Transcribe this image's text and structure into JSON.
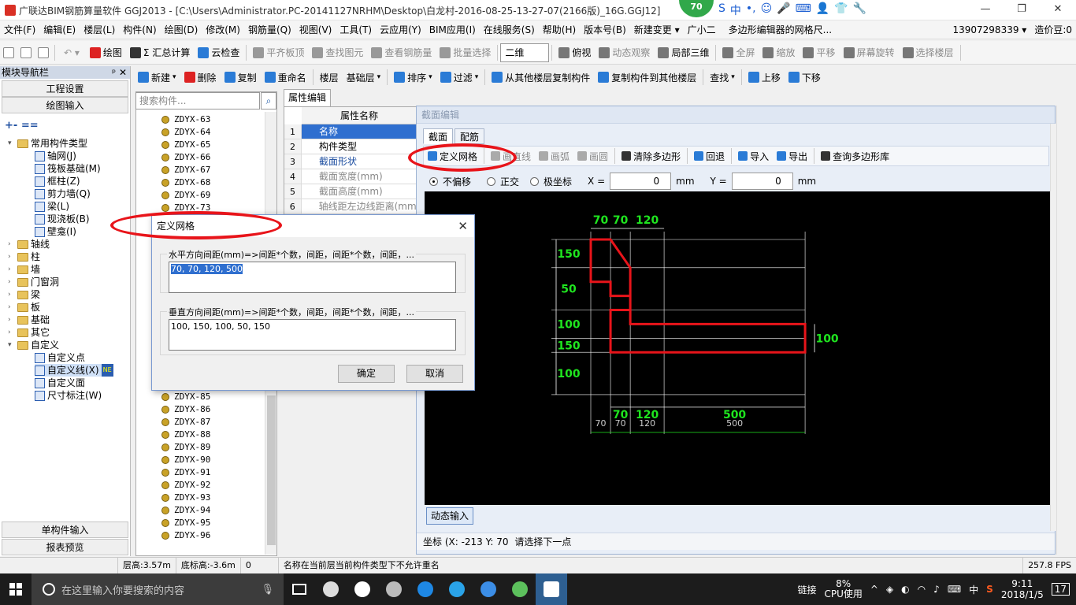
{
  "titlebar": {
    "title": "广联达BIM钢筋算量软件 GGJ2013 - [C:\\Users\\Administrator.PC-20141127NRHM\\Desktop\\白龙村-2016-08-25-13-27-07(2166版)_16G.GGJ12]",
    "badge": "70",
    "ime_items": [
      "S",
      "中",
      "•,",
      "☺",
      "🎤",
      "⌨",
      "👤",
      "👕",
      "🔧"
    ],
    "buttons": [
      "—",
      "❐",
      "✕"
    ]
  },
  "menubar": {
    "items": [
      "文件(F)",
      "编辑(E)",
      "楼层(L)",
      "构件(N)",
      "绘图(D)",
      "修改(M)",
      "钢筋量(Q)",
      "视图(V)",
      "工具(T)",
      "云应用(Y)",
      "BIM应用(I)",
      "在线服务(S)",
      "帮助(H)",
      "版本号(B)",
      "新建变更 ▾",
      "广小二",
      "多边形编辑器的网格尺...",
      "13907298339 ▾",
      "造价豆:0"
    ]
  },
  "toolbar1": {
    "items": [
      "绘图",
      "Σ 汇总计算",
      "云检查",
      "平齐板顶",
      "查找图元",
      "查看钢筋量",
      "批量选择",
      "二维",
      "俯视",
      "动态观察",
      "局部三维",
      "全屏",
      "缩放",
      "平移",
      "屏幕旋转",
      "选择楼层"
    ]
  },
  "toolbar2": {
    "items": [
      "新建",
      "删除",
      "复制",
      "重命名",
      "楼层",
      "基础层",
      "排序",
      "过滤",
      "从其他楼层复制构件",
      "复制构件到其他楼层",
      "查找",
      "上移",
      "下移"
    ]
  },
  "nav": {
    "title": "模块导航栏",
    "pin": "ᵖ ✕",
    "top_buttons": [
      "工程设置",
      "绘图输入"
    ],
    "bottom_buttons": [
      "单构件输入",
      "报表预览"
    ],
    "tree": [
      {
        "label": "常用构件类型",
        "level": 0,
        "type": "folder",
        "open": true
      },
      {
        "label": "轴网(J)",
        "level": 1,
        "type": "comp"
      },
      {
        "label": "筏板基础(M)",
        "level": 1,
        "type": "comp"
      },
      {
        "label": "框柱(Z)",
        "level": 1,
        "type": "comp"
      },
      {
        "label": "剪力墙(Q)",
        "level": 1,
        "type": "comp"
      },
      {
        "label": "梁(L)",
        "level": 1,
        "type": "comp"
      },
      {
        "label": "现浇板(B)",
        "level": 1,
        "type": "comp"
      },
      {
        "label": "壁龛(I)",
        "level": 1,
        "type": "comp"
      },
      {
        "label": "轴线",
        "level": 0,
        "type": "folder"
      },
      {
        "label": "柱",
        "level": 0,
        "type": "folder"
      },
      {
        "label": "墙",
        "level": 0,
        "type": "folder"
      },
      {
        "label": "门窗洞",
        "level": 0,
        "type": "folder"
      },
      {
        "label": "梁",
        "level": 0,
        "type": "folder"
      },
      {
        "label": "板",
        "level": 0,
        "type": "folder"
      },
      {
        "label": "基础",
        "level": 0,
        "type": "folder"
      },
      {
        "label": "其它",
        "level": 0,
        "type": "folder"
      },
      {
        "label": "自定义",
        "level": 0,
        "type": "folder",
        "open": true
      },
      {
        "label": "自定义点",
        "level": 1,
        "type": "comp"
      },
      {
        "label": "自定义线(X)",
        "level": 1,
        "type": "comp",
        "badge": "NE"
      },
      {
        "label": "自定义面",
        "level": 1,
        "type": "comp"
      },
      {
        "label": "尺寸标注(W)",
        "level": 1,
        "type": "comp"
      }
    ]
  },
  "component_list": {
    "search_placeholder": "搜索构件...",
    "items_top": [
      "ZDYX-63",
      "ZDYX-64",
      "ZDYX-65",
      "ZDYX-66",
      "ZDYX-67",
      "ZDYX-68",
      "ZDYX-69",
      "ZDYX-73"
    ],
    "items_bottom": [
      "ZDYX-85",
      "ZDYX-86",
      "ZDYX-87",
      "ZDYX-88",
      "ZDYX-89",
      "ZDYX-90",
      "ZDYX-91",
      "ZDYX-92",
      "ZDYX-93",
      "ZDYX-94",
      "ZDYX-95",
      "ZDYX-96"
    ]
  },
  "property": {
    "tab": "属性编辑",
    "header": "属性名称",
    "rows": [
      {
        "n": "1",
        "name": "名称"
      },
      {
        "n": "2",
        "name": "构件类型"
      },
      {
        "n": "3",
        "name": "截面形状"
      },
      {
        "n": "4",
        "name": "截面宽度(mm)"
      },
      {
        "n": "5",
        "name": "截面高度(mm)"
      },
      {
        "n": "6",
        "name": "轴线距左边线距离(mm)"
      }
    ]
  },
  "section_editor": {
    "title": "截面编辑",
    "tabs": [
      "截面",
      "配筋"
    ],
    "tools": [
      "定义网格",
      "画直线",
      "画弧",
      "画圆",
      "清除多边形",
      "回退",
      "导入",
      "导出",
      "查询多边形库"
    ],
    "options": [
      "不偏移",
      "正交",
      "极坐标"
    ],
    "x_label": "X =",
    "x_value": "0",
    "y_label": "Y =",
    "y_value": "0",
    "unit": "mm",
    "dynamic_input": "动态输入",
    "coord_text": "坐标 (X: -213 Y: 70",
    "coord_hint": "请选择下一点"
  },
  "drawing": {
    "x_spacing": [
      70,
      70,
      120,
      500
    ],
    "y_spacing": [
      100,
      150,
      100,
      50,
      150
    ],
    "top_labels": [
      "70",
      "70",
      "120"
    ],
    "left_labels": [
      "150",
      "50",
      "100",
      "150",
      "100"
    ],
    "bottom_labels": [
      "70",
      "120",
      "500"
    ],
    "bottom_grid_labels": [
      "70",
      "70",
      "120",
      "500"
    ],
    "right_label": "100",
    "colors": {
      "polygon": "#e8141a",
      "dim": "#1fe51f",
      "grid": "#ffffff"
    }
  },
  "dialog": {
    "title": "定义网格",
    "h_label": "水平方向间距(mm)=>间距*个数，间距，间距*个数，间距，...",
    "h_value": "70, 70, 120, 500",
    "v_label": "垂直方向间距(mm)=>间距*个数，间距，间距*个数，间距，...",
    "v_value": "100, 150, 100, 50, 150",
    "ok": "确定",
    "cancel": "取消"
  },
  "statusbar": {
    "floor_height": "层高:3.57m",
    "bottom_height": "底标高:-3.6m",
    "zero": "0",
    "message": "名称在当前层当前构件类型下不允许重名",
    "fps": "257.8 FPS"
  },
  "taskbar": {
    "search_placeholder": "在这里输入你要搜索的内容",
    "link": "链接",
    "cpu": "8%",
    "cpu_label": "CPU使用",
    "ime": "中",
    "time": "9:11",
    "date": "2018/1/5",
    "notif": "17"
  }
}
